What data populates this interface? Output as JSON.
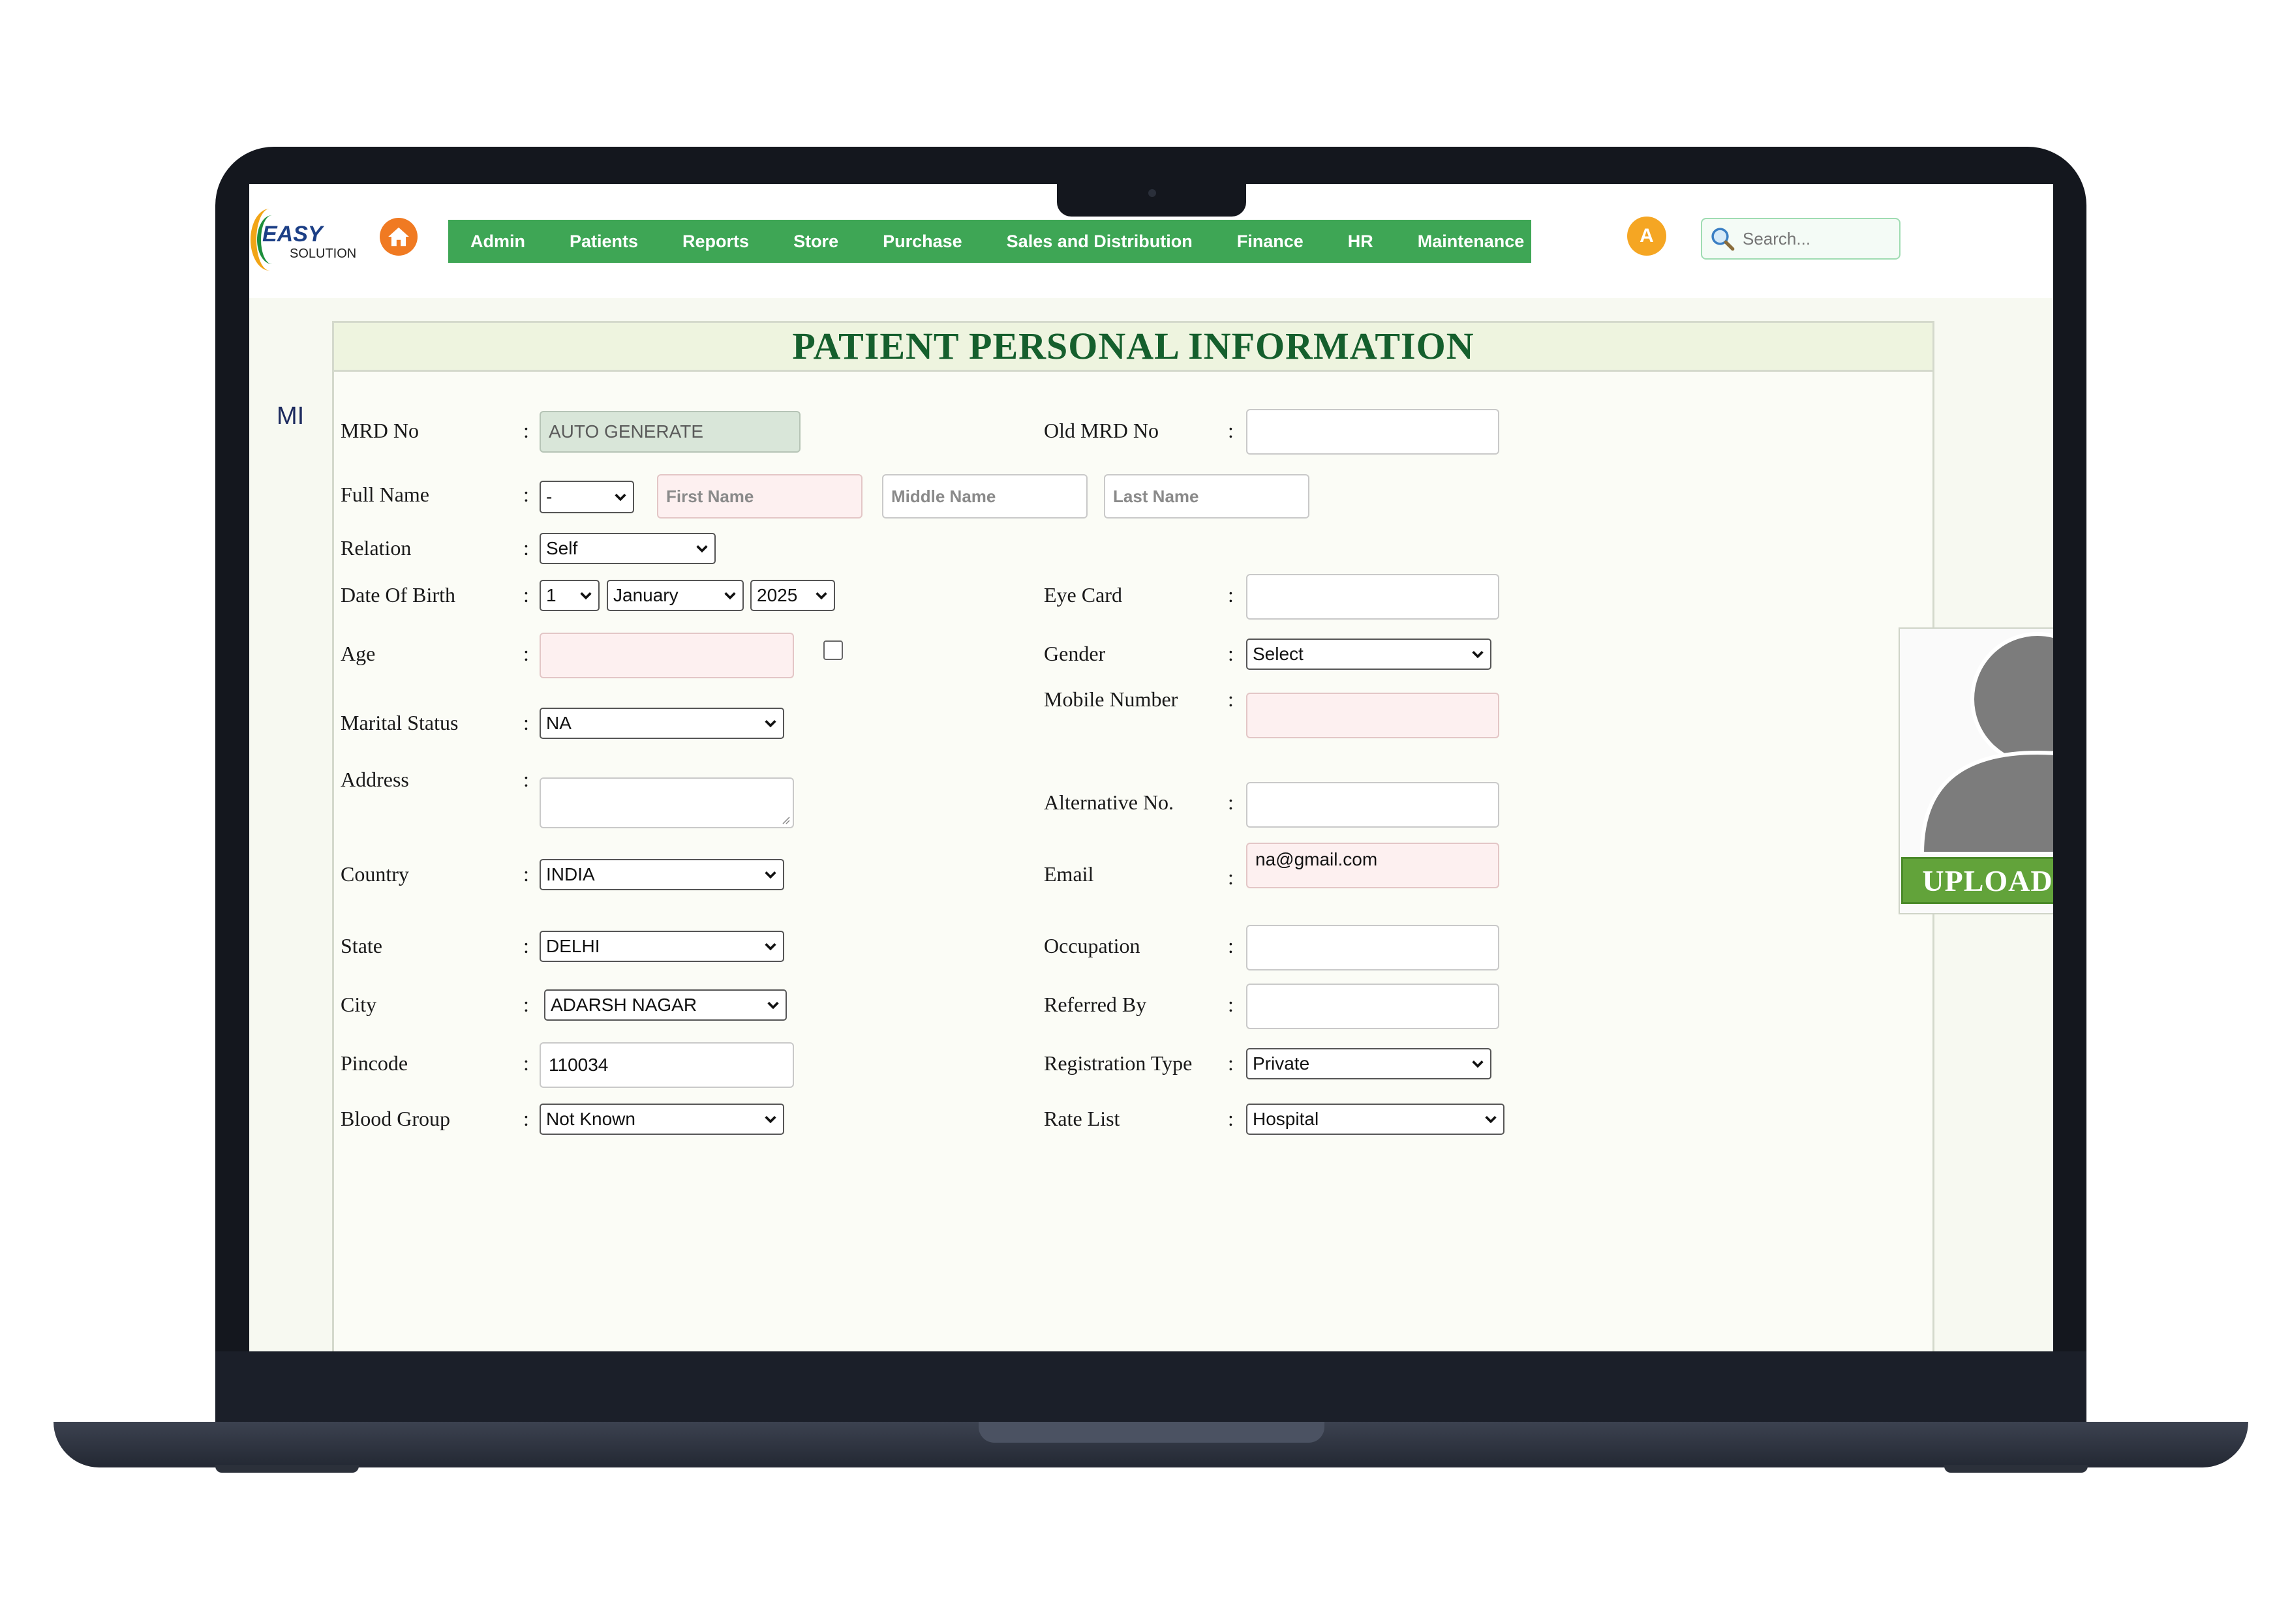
{
  "logo": {
    "line1": "EASY",
    "line2": "SOLUTION"
  },
  "nav": {
    "items": [
      "Admin",
      "Patients",
      "Reports",
      "Store",
      "Purchase",
      "Sales and Distribution",
      "Finance",
      "HR",
      "Maintenance"
    ]
  },
  "user": {
    "initial": "A"
  },
  "search": {
    "placeholder": "Search..."
  },
  "sidebar": {
    "label": "MI"
  },
  "form": {
    "title": "PATIENT PERSONAL INFORMATION",
    "colon": ":",
    "mrd_no": {
      "label": "MRD No",
      "value": "AUTO GENERATE"
    },
    "old_mrd_no": {
      "label": "Old MRD No",
      "value": ""
    },
    "full_name": {
      "label": "Full Name",
      "prefix": "-",
      "first_placeholder": "First Name",
      "middle_placeholder": "Middle Name",
      "last_placeholder": "Last Name"
    },
    "relation": {
      "label": "Relation",
      "value": "Self"
    },
    "dob": {
      "label": "Date Of Birth",
      "day": "1",
      "month": "January",
      "year": "2025"
    },
    "eye_card": {
      "label": "Eye Card",
      "value": ""
    },
    "age": {
      "label": "Age",
      "value": ""
    },
    "gender": {
      "label": "Gender",
      "value": "Select"
    },
    "mobile": {
      "label": "Mobile Number",
      "value": ""
    },
    "marital_status": {
      "label": "Marital Status",
      "value": "NA"
    },
    "address": {
      "label": "Address",
      "value": ""
    },
    "alternative_no": {
      "label": "Alternative No.",
      "value": ""
    },
    "country": {
      "label": "Country",
      "value": "INDIA"
    },
    "email": {
      "label": "Email",
      "value": "na@gmail.com"
    },
    "state": {
      "label": "State",
      "value": "DELHI"
    },
    "occupation": {
      "label": "Occupation",
      "value": ""
    },
    "city": {
      "label": "City",
      "value": "ADARSH NAGAR"
    },
    "referred_by": {
      "label": "Referred By",
      "value": ""
    },
    "pincode": {
      "label": "Pincode",
      "value": "110034"
    },
    "registration_type": {
      "label": "Registration Type",
      "value": "Private"
    },
    "blood_group": {
      "label": "Blood Group",
      "value": "Not Known"
    },
    "rate_list": {
      "label": "Rate List",
      "value": "Hospital"
    }
  },
  "photo": {
    "upload_label": "UPLOAD"
  },
  "colors": {
    "nav_green": "#3ea655",
    "title_green": "#155f2d",
    "upload_green": "#62a33a",
    "accent_orange": "#f07a22"
  }
}
